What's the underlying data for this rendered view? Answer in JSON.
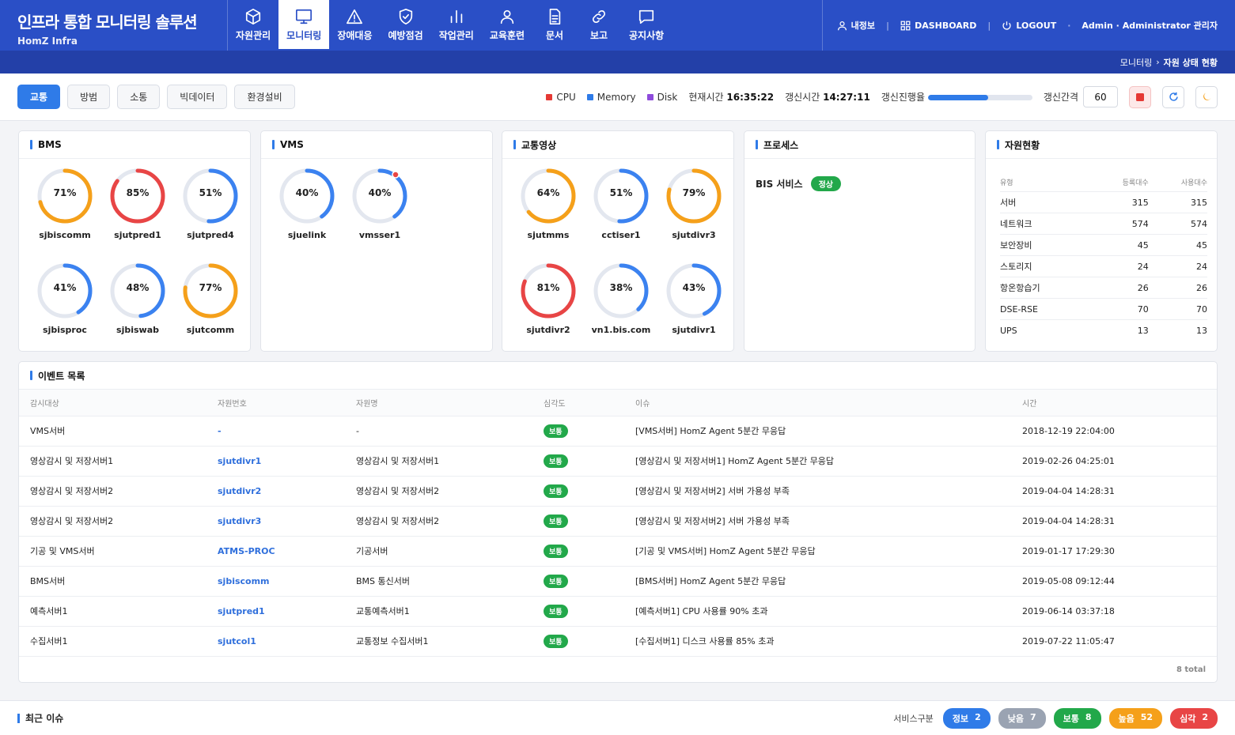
{
  "header": {
    "title": "인프라 통합 모니터링 솔루션",
    "subtitle": "HomZ Infra",
    "menu": [
      {
        "label": "자원관리",
        "icon": "cube-icon"
      },
      {
        "label": "모니터링",
        "icon": "monitor-icon"
      },
      {
        "label": "장애대응",
        "icon": "warning-icon"
      },
      {
        "label": "예방점검",
        "icon": "shield-check-icon"
      },
      {
        "label": "작업관리",
        "icon": "bar-chart-icon"
      },
      {
        "label": "교육훈련",
        "icon": "user-icon"
      },
      {
        "label": "문서",
        "icon": "document-icon"
      },
      {
        "label": "보고",
        "icon": "link-icon"
      },
      {
        "label": "공지사항",
        "icon": "chat-icon"
      }
    ],
    "my_info": "내정보",
    "dashboard": "DASHBOARD",
    "logout": "LOGOUT",
    "user": "Admin · Administrator 관리자"
  },
  "breadcrumb": {
    "parent": "모니터링",
    "sep": "›",
    "current": "자원 상태 현황"
  },
  "toolbar": {
    "tabs": [
      "교통",
      "방범",
      "소통",
      "빅데이터",
      "환경설비"
    ],
    "legend": [
      {
        "label": "CPU",
        "color": "#e53935"
      },
      {
        "label": "Memory",
        "color": "#2f7be8"
      },
      {
        "label": "Disk",
        "color": "#8e4bdc"
      }
    ],
    "current_time_label": "현재시간",
    "current_time": "16:35:22",
    "refresh_time_label": "갱신시간",
    "refresh_time": "14:27:11",
    "refresh_progress_label": "갱신진행율",
    "refresh_progress": 0.58,
    "interval_label": "갱신간격",
    "interval_value": "60"
  },
  "colors": {
    "orange": "#f5a01a",
    "red": "#e84545",
    "blue": "#3b82f0",
    "track": "#e3e7ef"
  },
  "bms": {
    "title": "BMS",
    "gauges": [
      {
        "name": "sjbiscomm",
        "label": "71%",
        "value": 71,
        "color": "orange"
      },
      {
        "name": "sjutpred1",
        "label": "85%",
        "value": 85,
        "color": "red"
      },
      {
        "name": "sjutpred4",
        "label": "51%",
        "value": 51,
        "color": "blue"
      },
      {
        "name": "sjbisproc",
        "label": "41%",
        "value": 41,
        "color": "blue"
      },
      {
        "name": "sjbiswab",
        "label": "48%",
        "value": 48,
        "color": "blue"
      },
      {
        "name": "sjutcomm",
        "label": "77%",
        "value": 77,
        "color": "orange"
      }
    ]
  },
  "vms": {
    "title": "VMS",
    "gauges": [
      {
        "name": "sjuelink",
        "label": "40%",
        "value": 40,
        "color": "blue"
      },
      {
        "name": "vmsser1",
        "label": "40%",
        "value": 40,
        "color": "blue",
        "alert": true
      }
    ]
  },
  "video": {
    "title": "교통영상",
    "gauges": [
      {
        "name": "sjutmms",
        "label": "64%",
        "value": 64,
        "color": "orange"
      },
      {
        "name": "cctiser1",
        "label": "51%",
        "value": 51,
        "color": "blue"
      },
      {
        "name": "sjutdivr3",
        "label": "79%",
        "value": 79,
        "color": "orange"
      },
      {
        "name": "sjutdivr2",
        "label": "81%",
        "value": 81,
        "color": "red"
      },
      {
        "name": "vn1.bis.com",
        "label": "38%",
        "value": 38,
        "color": "blue"
      },
      {
        "name": "sjutdivr1",
        "label": "43%",
        "value": 43,
        "color": "blue"
      }
    ]
  },
  "process": {
    "title": "프로세스",
    "name": "BIS 서비스",
    "status": "정상"
  },
  "resources": {
    "title": "자원현황",
    "headers": [
      "유형",
      "등록대수",
      "사용대수"
    ],
    "rows": [
      [
        "서버",
        "315",
        "315"
      ],
      [
        "네트워크",
        "574",
        "574"
      ],
      [
        "보안장비",
        "45",
        "45"
      ],
      [
        "스토리지",
        "24",
        "24"
      ],
      [
        "항온항습기",
        "26",
        "26"
      ],
      [
        "DSE-RSE",
        "70",
        "70"
      ],
      [
        "UPS",
        "13",
        "13"
      ]
    ]
  },
  "events": {
    "title": "이벤트 목록",
    "headers": [
      "감시대상",
      "자원번호",
      "자원명",
      "심각도",
      "이슈",
      "시간"
    ],
    "rows": [
      [
        "VMS서버",
        "-",
        "-",
        "보통",
        "[VMS서버] HomZ Agent 5분간 무응답",
        "2018-12-19 22:04:00"
      ],
      [
        "영상감시 및 저장서버1",
        "sjutdivr1",
        "영상감시 및 저장서버1",
        "보통",
        "[영상감시 및 저장서버1] HomZ Agent 5분간 무응답",
        "2019-02-26 04:25:01"
      ],
      [
        "영상감시 및 저장서버2",
        "sjutdivr2",
        "영상감시 및 저장서버2",
        "보통",
        "[영상감시 및 저장서버2] 서버 가용성 부족",
        "2019-04-04 14:28:31"
      ],
      [
        "영상감시 및 저장서버2",
        "sjutdivr3",
        "영상감시 및 저장서버2",
        "보통",
        "[영상감시 및 저장서버2] 서버 가용성 부족",
        "2019-04-04 14:28:31"
      ],
      [
        "기공 및 VMS서버",
        "ATMS-PROC",
        "기공서버",
        "보통",
        "[기공 및 VMS서버] HomZ Agent 5분간 무응답",
        "2019-01-17 17:29:30"
      ],
      [
        "BMS서버",
        "sjbiscomm",
        "BMS 통신서버",
        "보통",
        "[BMS서버] HomZ Agent 5분간 무응답",
        "2019-05-08 09:12:44"
      ],
      [
        "예측서버1",
        "sjutpred1",
        "교통예측서버1",
        "보통",
        "[예측서버1] CPU 사용률 90% 초과",
        "2019-06-14 03:37:18"
      ],
      [
        "수집서버1",
        "sjutcol1",
        "교통정보 수집서버1",
        "보통",
        "[수집서버1] 디스크 사용률 85% 초과",
        "2019-07-22 11:05:47"
      ]
    ],
    "total": "8 total"
  },
  "recent": {
    "title": "최근 이슈",
    "service_label": "서비스구분",
    "pills": [
      {
        "label": "정보",
        "count": "2",
        "color": "#2f7be8"
      },
      {
        "label": "낮음",
        "count": "7",
        "color": "#9aa3b2"
      },
      {
        "label": "보통",
        "count": "8",
        "color": "#22a84a"
      },
      {
        "label": "높음",
        "count": "52",
        "color": "#f5a01a"
      },
      {
        "label": "심각",
        "count": "2",
        "color": "#e84545"
      }
    ]
  }
}
